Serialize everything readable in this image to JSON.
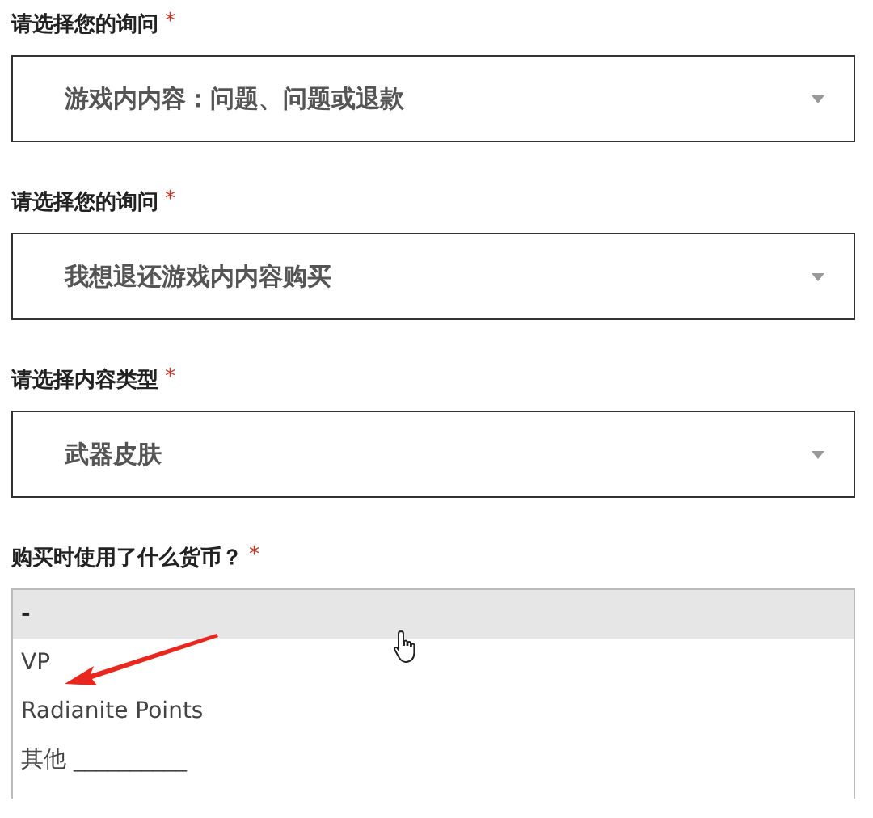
{
  "fields": [
    {
      "label": "请选择您的询问",
      "required_mark": "*",
      "value": "游戏内内容：问题、问题或退款"
    },
    {
      "label": "请选择您的询问",
      "required_mark": "*",
      "value": "我想退还游戏内内容购买"
    },
    {
      "label": "请选择内容类型",
      "required_mark": "*",
      "value": "武器皮肤"
    }
  ],
  "currency": {
    "label": "购买时使用了什么货币？",
    "required_mark": "*",
    "options": [
      {
        "text": "-",
        "selected": true
      },
      {
        "text": "VP",
        "selected": false
      },
      {
        "text": "Radianite Points",
        "selected": false
      },
      {
        "text": "其他 __________",
        "selected": false
      }
    ]
  }
}
